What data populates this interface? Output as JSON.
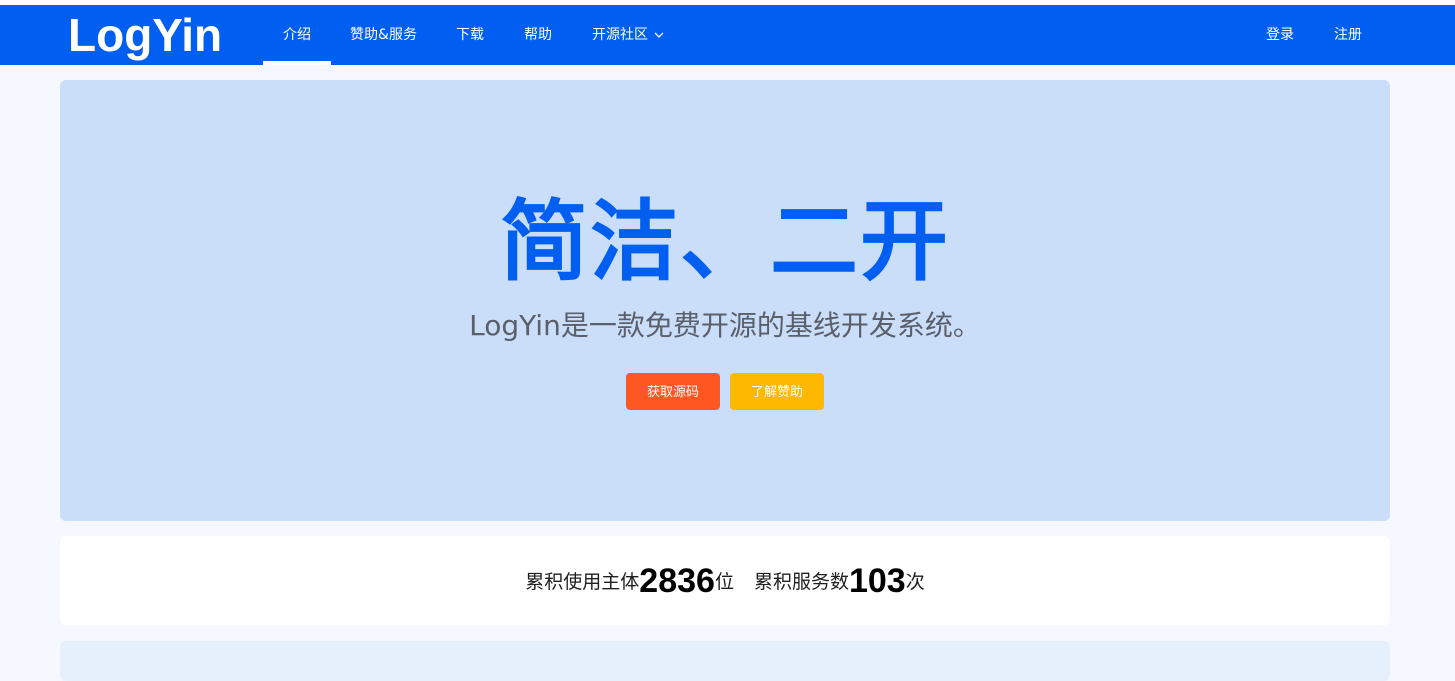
{
  "brand": {
    "logo": "LogYin",
    "accent": "#005ff0"
  },
  "nav": {
    "items": [
      {
        "label": "介绍",
        "active": true
      },
      {
        "label": "赞助&服务",
        "active": false
      },
      {
        "label": "下载",
        "active": false
      },
      {
        "label": "帮助",
        "active": false
      },
      {
        "label": "开源社区",
        "active": false,
        "icon": "chevron-down-icon"
      }
    ],
    "login": "登录",
    "register": "注册"
  },
  "hero": {
    "title": "简洁、二开",
    "subtitle": "LogYin是一款免费开源的基线开发系统。",
    "buttons": {
      "source": {
        "label": "获取源码",
        "color": "#ff5722"
      },
      "sponsor": {
        "label": "了解赞助",
        "color": "#ffb800"
      }
    }
  },
  "stats": {
    "users_prefix": "累积使用主体",
    "users_count": "2836",
    "users_unit": "位",
    "services_prefix": "累积服务数",
    "services_count": "103",
    "services_unit": "次"
  }
}
